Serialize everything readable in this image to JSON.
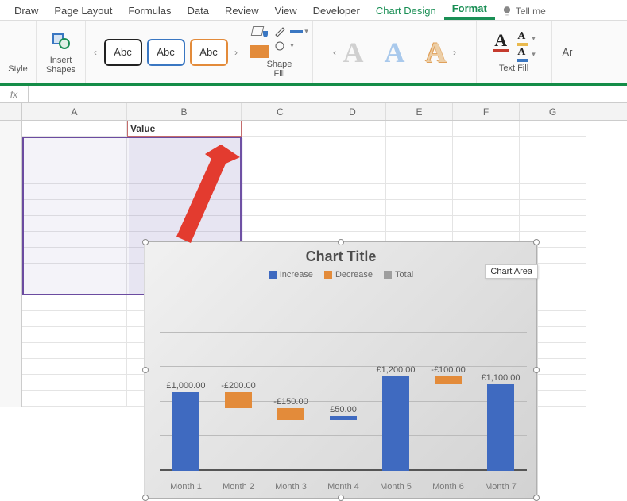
{
  "tabs": {
    "items": [
      "Draw",
      "Page Layout",
      "Formulas",
      "Data",
      "Review",
      "View",
      "Developer",
      "Chart Design",
      "Format"
    ],
    "contextual": [
      "Chart Design",
      "Format"
    ],
    "active": "Format",
    "tellme": "Tell me"
  },
  "ribbon": {
    "style_group_label": "Style",
    "insert_shapes_label": "Insert\nShapes",
    "shape_styles": {
      "abc": "Abc"
    },
    "shape_fill_label": "Shape\nFill",
    "text_fill_label": "Text Fill",
    "wordart_fragment": "Ar"
  },
  "formula_bar": {
    "fx": "fx",
    "value": ""
  },
  "columns": [
    "A",
    "B",
    "C",
    "D",
    "E",
    "F",
    "G"
  ],
  "cells": {
    "B1": "Value"
  },
  "chart_data": {
    "type": "waterfall",
    "title": "Chart Title",
    "legend": [
      "Increase",
      "Decrease",
      "Total"
    ],
    "categories": [
      "Month 1",
      "Month 2",
      "Month 3",
      "Month 4",
      "Month 5",
      "Month 6",
      "Month 7"
    ],
    "values": [
      1000.0,
      -200.0,
      -150.0,
      50.0,
      1200.0,
      -100.0,
      1100.0
    ],
    "labels": [
      "£1,000.00",
      "-£200.00",
      "-£150.00",
      "£50.00",
      "£1,200.00",
      "-£100.00",
      "£1,100.00"
    ],
    "colors": {
      "increase": "#3f6ac0",
      "decrease": "#e38b3a",
      "total": "#9e9e9e"
    },
    "ylim": [
      0,
      2200
    ],
    "tooltip": "Chart Area"
  }
}
